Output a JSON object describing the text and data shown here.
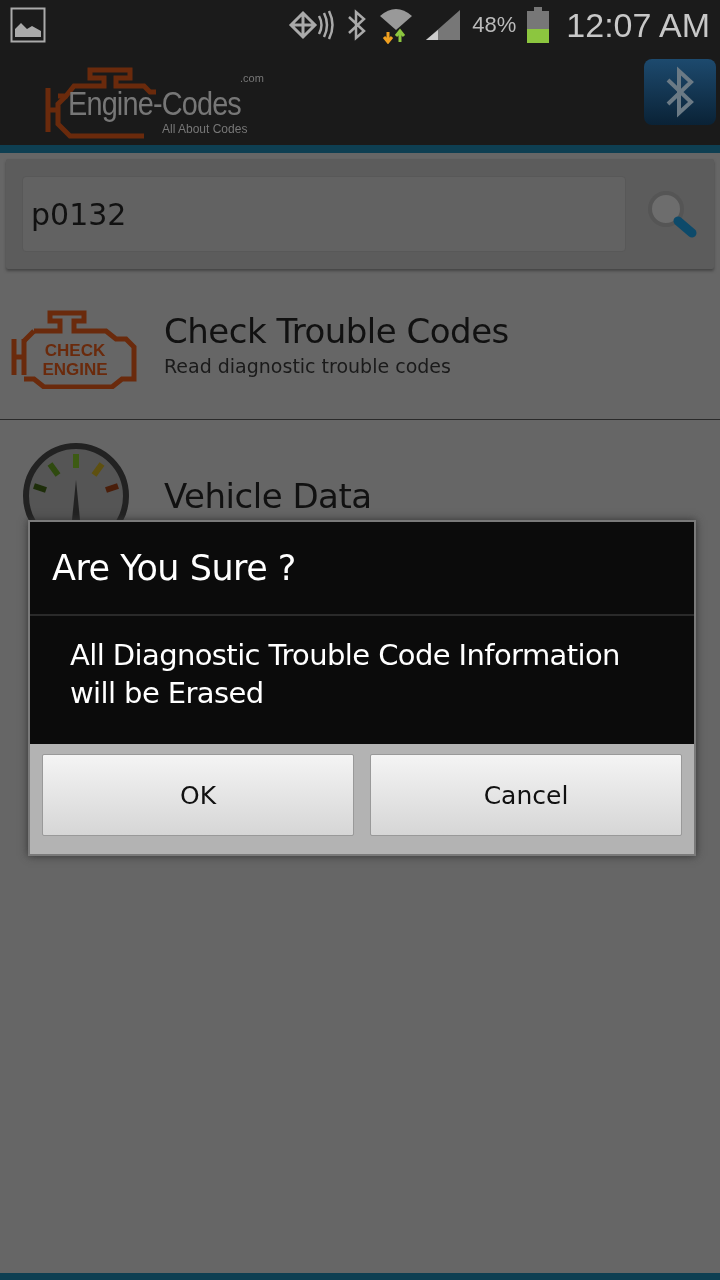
{
  "status_bar": {
    "battery": "48%",
    "time": "12:07 AM"
  },
  "header": {
    "logo": {
      "name": "Engine-Codes",
      "domain": ".com",
      "tagline": "All About Codes"
    }
  },
  "search": {
    "value": "p0132"
  },
  "menu": [
    {
      "kind": "engine",
      "title": "Check Trouble Codes",
      "subtitle": "Read diagnostic trouble codes",
      "icon_lines": [
        "CHECK",
        "ENGINE"
      ]
    },
    {
      "kind": "gauge",
      "title": "Vehicle Data"
    }
  ],
  "dialog": {
    "title": "Are You Sure ?",
    "message": "All Diagnostic Trouble Code Information will be Erased",
    "buttons": [
      "OK",
      "Cancel"
    ]
  }
}
